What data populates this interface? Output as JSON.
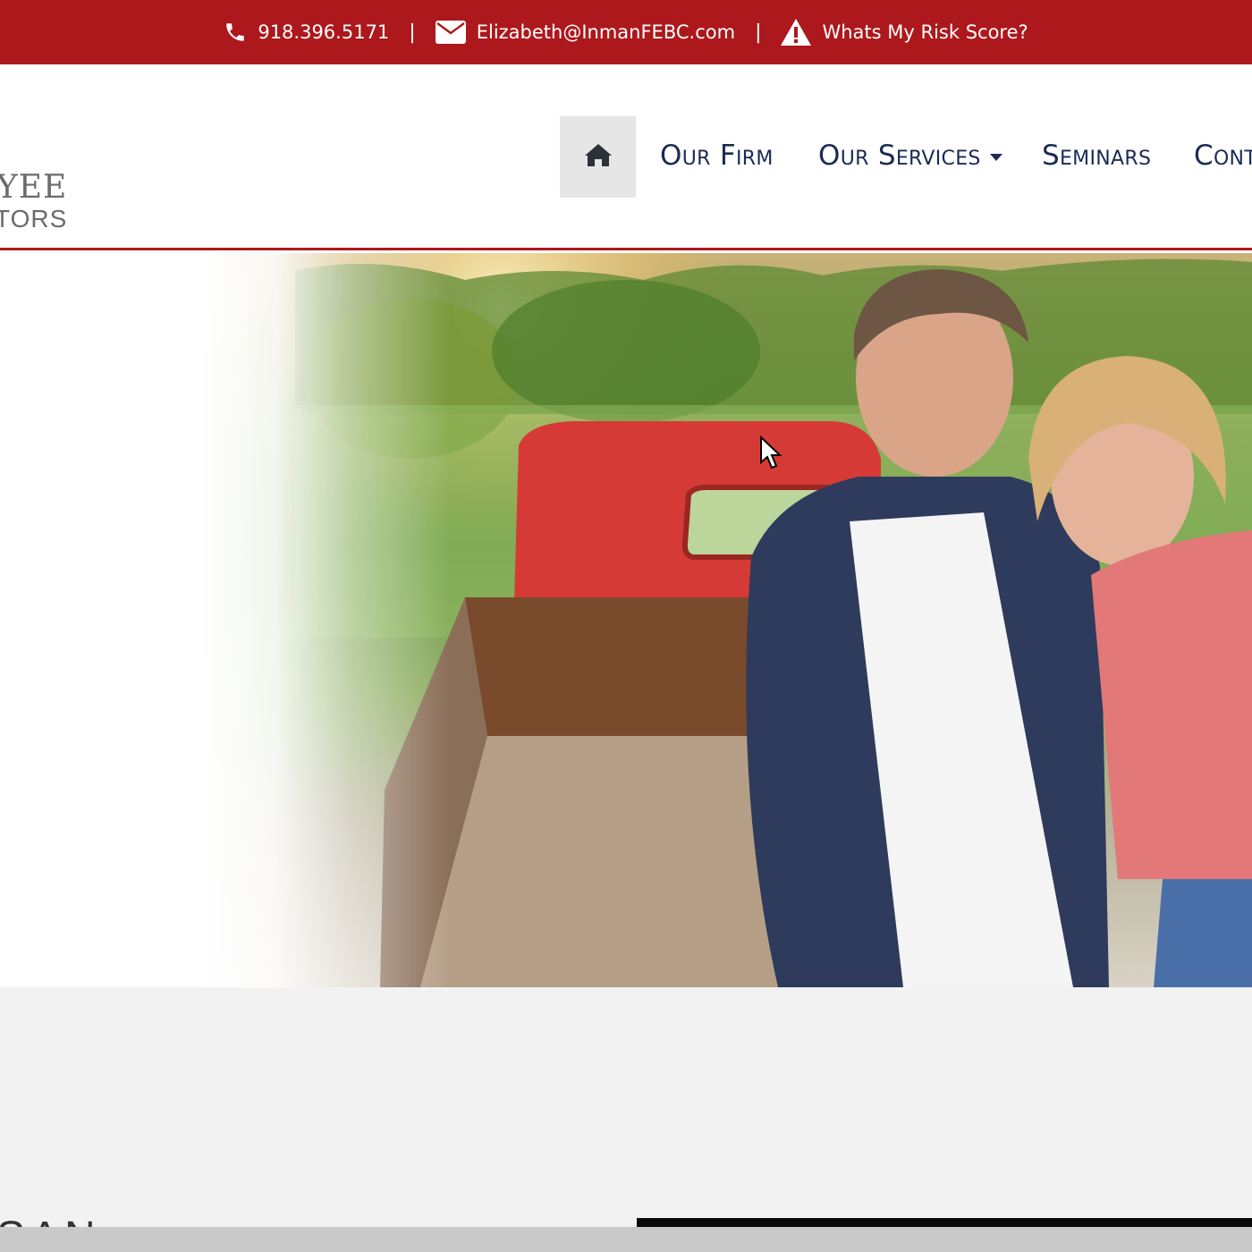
{
  "topbar": {
    "phone": "918.396.5171",
    "email": "Elizabeth@InmanFEBC.com",
    "risk_link": "Whats My Risk Score?",
    "separator": "|",
    "icons": [
      "phone-icon",
      "envelope-icon",
      "warning-icon"
    ]
  },
  "logo": {
    "line1": "YEE",
    "line2": "TORS"
  },
  "nav": {
    "home_icon": "home-icon",
    "items": [
      {
        "label": "Our Firm"
      },
      {
        "label": "Our Services",
        "has_dropdown": true
      },
      {
        "label": "Seminars"
      },
      {
        "label": "Cont"
      }
    ]
  },
  "lower": {
    "heading_fragment": "SAN ZIMBABWE"
  },
  "colors": {
    "brand_red": "#ad181c",
    "nav_text": "#1b2a56",
    "home_bg": "#e6e6e6",
    "section_bg": "#f2f2f2"
  }
}
